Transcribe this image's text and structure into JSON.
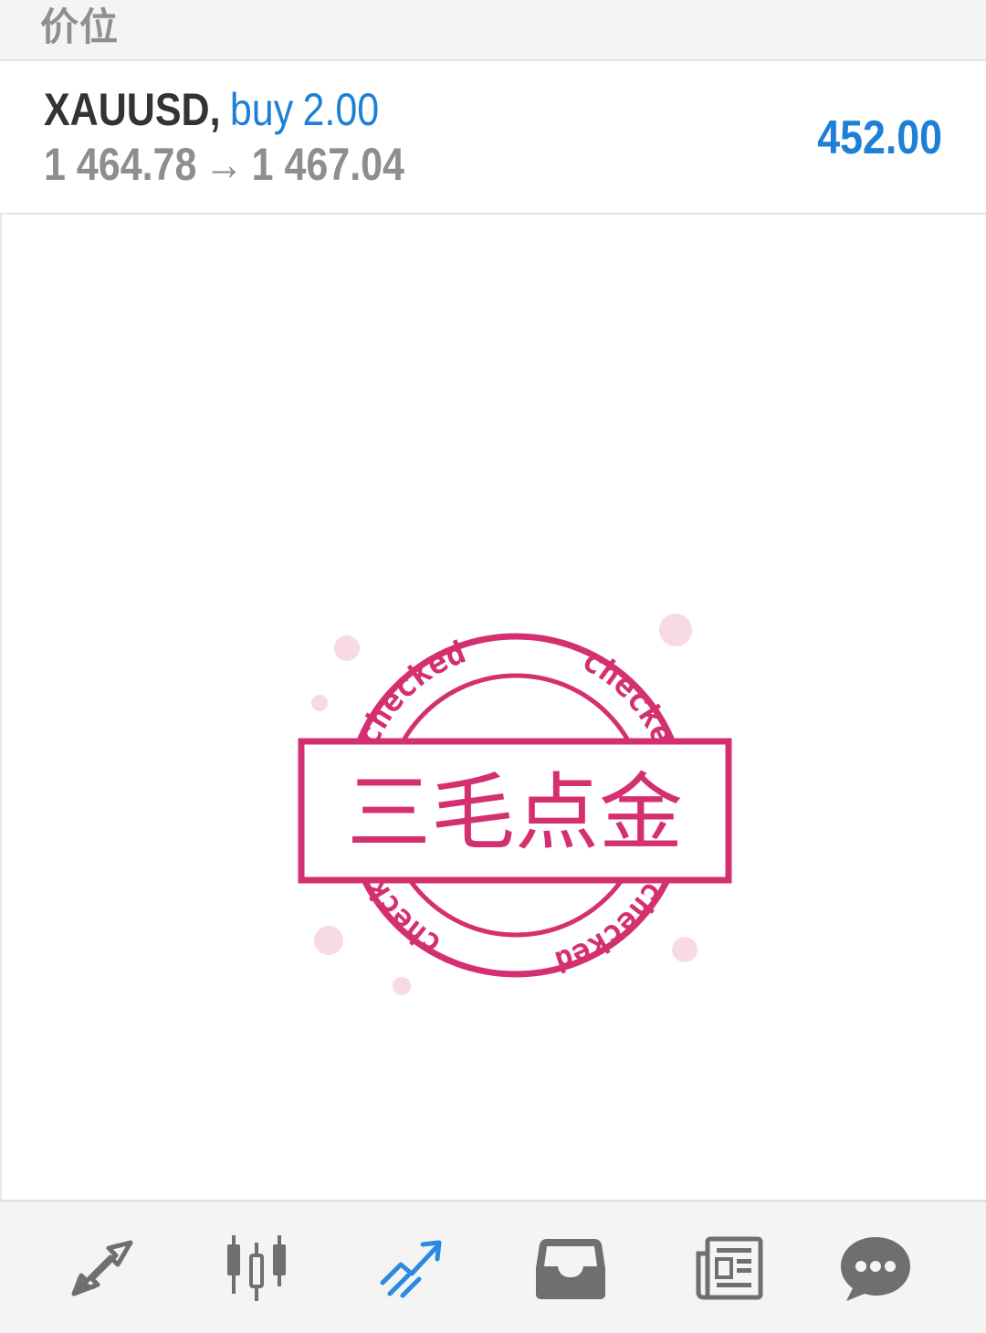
{
  "header": {
    "title": "价位"
  },
  "position": {
    "symbol": "XAUUSD",
    "separator": ",",
    "type": "buy",
    "volume": "2.00",
    "open_price": "1 464.78",
    "arrow": "→",
    "current_price": "1 467.04",
    "profit": "452.00"
  },
  "watermark": {
    "main_text": "三毛点金",
    "ring_text": "checked",
    "color": "#d4306f"
  },
  "bottom_nav": {
    "items": [
      {
        "icon": "quotes-arrows-icon",
        "active": false
      },
      {
        "icon": "chart-candles-icon",
        "active": false
      },
      {
        "icon": "trade-icon",
        "active": true
      },
      {
        "icon": "history-inbox-icon",
        "active": false
      },
      {
        "icon": "news-icon",
        "active": false
      },
      {
        "icon": "chat-icon",
        "active": false
      }
    ],
    "active_color": "#2a8ae0",
    "inactive_color": "#6f6f6f"
  }
}
